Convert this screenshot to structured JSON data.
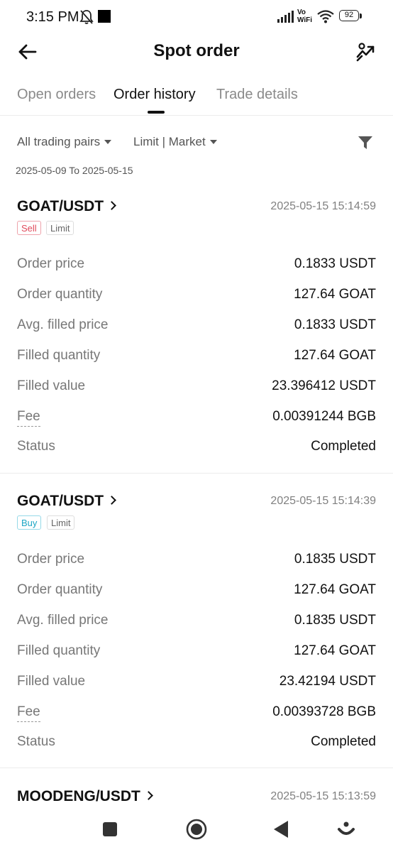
{
  "status_bar": {
    "time": "3:15 PM",
    "vowifi_top": "Vo",
    "vowifi_bottom": "WiFi",
    "battery": "92"
  },
  "header": {
    "title": "Spot order"
  },
  "tabs": [
    {
      "label": "Open orders"
    },
    {
      "label": "Order history",
      "active": true
    },
    {
      "label": "Trade details"
    }
  ],
  "filters": {
    "pairs": "All trading pairs",
    "order_type": "Limit | Market",
    "date_range": "2025-05-09 To 2025-05-15"
  },
  "orders": [
    {
      "pair": "GOAT/USDT",
      "time": "2025-05-15 15:14:59",
      "side": "Sell",
      "type": "Limit",
      "rows": [
        {
          "label": "Order price",
          "value": "0.1833 USDT"
        },
        {
          "label": "Order quantity",
          "value": "127.64 GOAT"
        },
        {
          "label": "Avg. filled price",
          "value": "0.1833 USDT"
        },
        {
          "label": "Filled quantity",
          "value": "127.64 GOAT"
        },
        {
          "label": "Filled value",
          "value": "23.396412 USDT"
        },
        {
          "label": "Fee",
          "value": "0.00391244 BGB"
        },
        {
          "label": "Status",
          "value": "Completed"
        }
      ]
    },
    {
      "pair": "GOAT/USDT",
      "time": "2025-05-15 15:14:39",
      "side": "Buy",
      "type": "Limit",
      "rows": [
        {
          "label": "Order price",
          "value": "0.1835 USDT"
        },
        {
          "label": "Order quantity",
          "value": "127.64 GOAT"
        },
        {
          "label": "Avg. filled price",
          "value": "0.1835 USDT"
        },
        {
          "label": "Filled quantity",
          "value": "127.64 GOAT"
        },
        {
          "label": "Filled value",
          "value": "23.42194 USDT"
        },
        {
          "label": "Fee",
          "value": "0.00393728 BGB"
        },
        {
          "label": "Status",
          "value": "Completed"
        }
      ]
    },
    {
      "pair": "MOODENG/USDT",
      "time": "2025-05-15 15:13:59"
    }
  ],
  "colors": {
    "sell": "#e04a5b",
    "buy": "#1da6c4",
    "text": "#111111",
    "muted": "#777777"
  },
  "icons": [
    "bell-off-icon",
    "signal-icon",
    "wifi-icon",
    "battery-icon",
    "back-arrow-icon",
    "chart-share-icon",
    "filter-icon",
    "nav-square-icon",
    "nav-home-icon",
    "nav-back-icon",
    "nav-assistant-icon"
  ]
}
